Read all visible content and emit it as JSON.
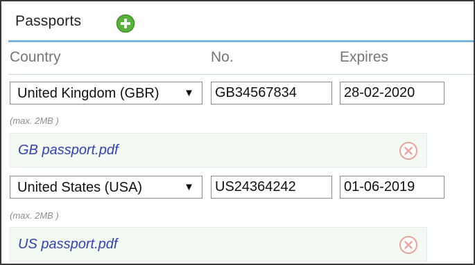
{
  "panel": {
    "title": "Passports"
  },
  "columns": {
    "country": "Country",
    "number": "No.",
    "expires": "Expires"
  },
  "passports": [
    {
      "country": "United Kingdom (GBR)",
      "number": "GB34567834",
      "expires": "28-02-2020",
      "max_size_note": "(max. 2MB )",
      "file_name": "GB passport.pdf"
    },
    {
      "country": "United States (USA)",
      "number": "US24364242",
      "expires": "01-06-2019",
      "max_size_note": "(max. 2MB )",
      "file_name": "US passport.pdf"
    }
  ],
  "icons": {
    "add": "plus-circle-icon",
    "remove": "remove-circle-icon",
    "dropdown": "chevron-down-icon"
  },
  "colors": {
    "accent_line": "#7ab4de",
    "add_icon": "#57b33a",
    "remove_icon": "#e8a49b",
    "link": "#3441b4",
    "file_box_bg": "#f3faf3"
  }
}
